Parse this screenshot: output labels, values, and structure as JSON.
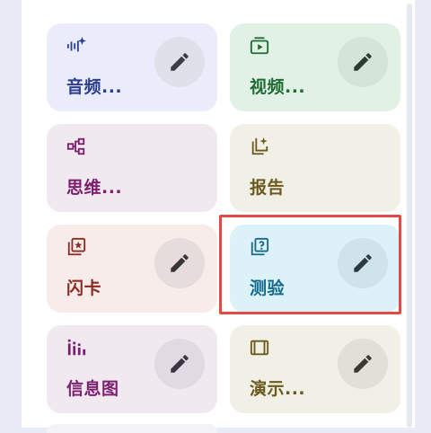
{
  "tiles": [
    {
      "id": "audio",
      "label": "音频...",
      "icon": "audio-spark-icon",
      "bg": "#eaedf9",
      "fg": "#2c3e8f",
      "edit": true
    },
    {
      "id": "video",
      "label": "视频...",
      "icon": "video-play-icon",
      "bg": "#e2f1e6",
      "fg": "#1f6b34",
      "edit": true
    },
    {
      "id": "mindmap",
      "label": "思维...",
      "icon": "mindmap-icon",
      "bg": "#f1e9f0",
      "fg": "#7b1f6e",
      "edit": false
    },
    {
      "id": "report",
      "label": "报告",
      "icon": "report-spark-icon",
      "bg": "#f1f0e6",
      "fg": "#6b5a1e",
      "edit": false
    },
    {
      "id": "flashcards",
      "label": "闪卡",
      "icon": "flashcard-star-icon",
      "bg": "#f7ece9",
      "fg": "#8a2b24",
      "edit": true
    },
    {
      "id": "quiz",
      "label": "测验",
      "icon": "quiz-question-icon",
      "bg": "#ddf1f8",
      "fg": "#136a8c",
      "edit": true
    },
    {
      "id": "infographic",
      "label": "信息图",
      "icon": "infographic-bars-icon",
      "bg": "#f1e9f0",
      "fg": "#7b1f6e",
      "edit": true
    },
    {
      "id": "slides",
      "label": "演示...",
      "icon": "slides-icon",
      "bg": "#f1f0e6",
      "fg": "#6b5a1e",
      "edit": true
    }
  ],
  "edit_icon": "pencil-icon",
  "colors": {
    "highlight": "#e04b48",
    "edit_button_bg": "#dfe1ea"
  }
}
